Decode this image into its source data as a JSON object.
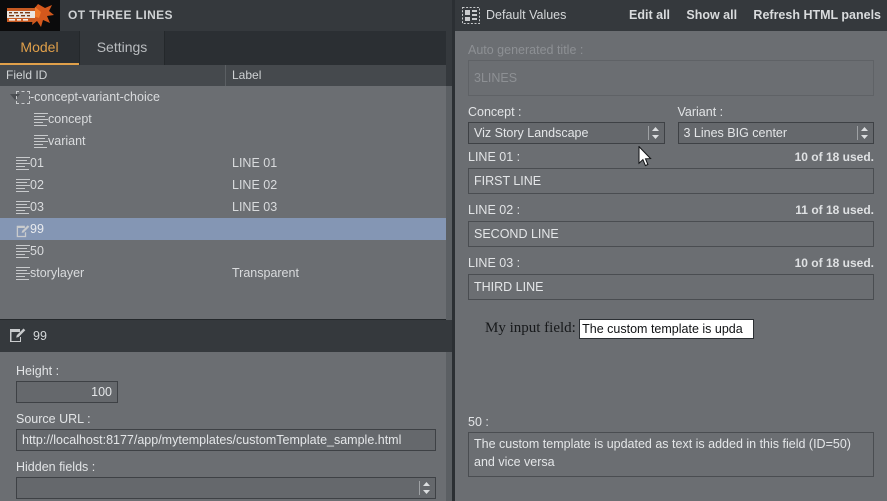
{
  "window": {
    "logo_icon": "splatter-logo-icon",
    "doc_title": "OT THREE LINES"
  },
  "tabs": [
    {
      "label": "Model",
      "active": true
    },
    {
      "label": "Settings",
      "active": false
    }
  ],
  "tree": {
    "columns": [
      "Field ID",
      "Label"
    ],
    "rows": [
      {
        "id": "-concept-variant-choice",
        "label": "",
        "icon": "dashed-box-icon",
        "indent": 30,
        "twisty": true,
        "selected": false
      },
      {
        "id": "concept",
        "label": "",
        "icon": "text-lines-icon",
        "indent": 48,
        "twisty": false,
        "selected": false
      },
      {
        "id": "variant",
        "label": "",
        "icon": "text-lines-icon",
        "indent": 48,
        "twisty": false,
        "selected": false
      },
      {
        "id": "01",
        "label": "LINE 01",
        "icon": "text-lines-icon",
        "indent": 30,
        "twisty": false,
        "selected": false
      },
      {
        "id": "02",
        "label": "LINE 02",
        "icon": "text-lines-icon",
        "indent": 30,
        "twisty": false,
        "selected": false
      },
      {
        "id": "03",
        "label": "LINE 03",
        "icon": "text-lines-icon",
        "indent": 30,
        "twisty": false,
        "selected": false
      },
      {
        "id": "99",
        "label": "",
        "icon": "edit-square-icon",
        "indent": 30,
        "twisty": false,
        "selected": true
      },
      {
        "id": "50",
        "label": "",
        "icon": "text-lines-icon",
        "indent": 30,
        "twisty": false,
        "selected": false
      },
      {
        "id": "storylayer",
        "label": "Transparent",
        "icon": "text-lines-icon",
        "indent": 30,
        "twisty": false,
        "selected": false
      }
    ]
  },
  "details": {
    "header_icon": "edit-square-icon",
    "header_title": "99",
    "height_label": "Height :",
    "height_value": "100",
    "source_url_label": "Source URL :",
    "source_url_value": "http://localhost:8177/app/mytemplates/customTemplate_sample.html",
    "hidden_fields_label": "Hidden fields :",
    "hidden_fields_value": ""
  },
  "right_panel": {
    "header_icon": "panels-layout-icon",
    "header_title": "Default Values",
    "actions": [
      {
        "label": "Edit all"
      },
      {
        "label": "Show all"
      },
      {
        "label": "Refresh HTML panels"
      }
    ],
    "auto_title": {
      "label": "Auto generated title :",
      "value": "3LINES"
    },
    "concept": {
      "label": "Concept :",
      "value": "Viz Story Landscape"
    },
    "variant": {
      "label": "Variant :",
      "value": "3 Lines BIG center"
    },
    "lines": [
      {
        "label": "LINE 01 :",
        "counter": "10 of 18 used.",
        "value": "FIRST LINE"
      },
      {
        "label": "LINE 02 :",
        "counter": "11 of 18 used.",
        "value": "SECOND LINE"
      },
      {
        "label": "LINE 03 :",
        "counter": "10 of 18 used.",
        "value": "THIRD LINE"
      }
    ],
    "custom_panel": {
      "label": "My input field:",
      "value": "The custom template is upda"
    },
    "field50": {
      "label": "50 :",
      "value": "The custom template is updated as text is added in this field (ID=50) and vice versa"
    }
  },
  "colors": {
    "accent": "#e0a04a",
    "selection": "#8496b4",
    "panel_bg": "#6b6e72",
    "header_bg": "#35393d"
  },
  "cursor": {
    "icon": "mouse-pointer-icon"
  }
}
